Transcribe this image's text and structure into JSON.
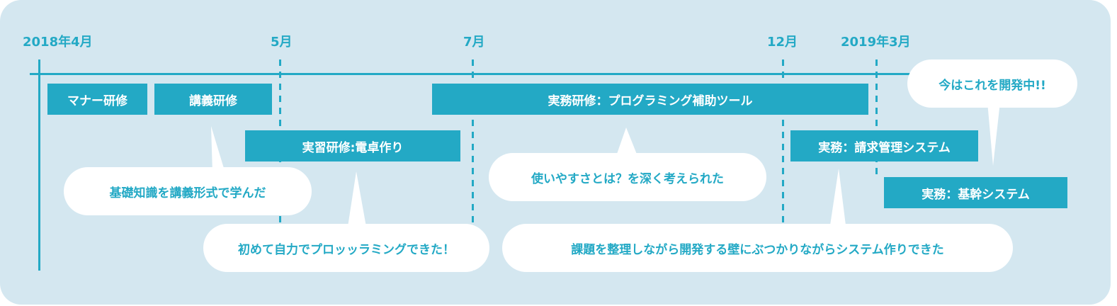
{
  "colors": {
    "accent": "#23a9c5",
    "panel_background": "#d4e7f0",
    "bubble": "#ffffff"
  },
  "timeline": {
    "dates": [
      "2018年4月",
      "5月",
      "7月",
      "12月",
      "2019年3月"
    ]
  },
  "bars": {
    "manner_training": "マナー研修",
    "lecture_training": "講義研修",
    "practice_training": "実習研修:電卓作り",
    "work_training": "実務研修：プログラミング補助ツール",
    "billing_system": "実務：請求管理システム",
    "core_system": "実務：基幹システム"
  },
  "bubbles": {
    "lecture_comment": "基礎知識を講義形式で学んだ",
    "practice_comment": "初めて自力でプロッッラミングできた！",
    "usability_comment": "使いやすさとは？を深く考えられた",
    "billing_comment": "課題を整理しながら開発する壁にぶつかりながらシステム作りできた",
    "current_comment": "今はこれを開発中!!"
  }
}
